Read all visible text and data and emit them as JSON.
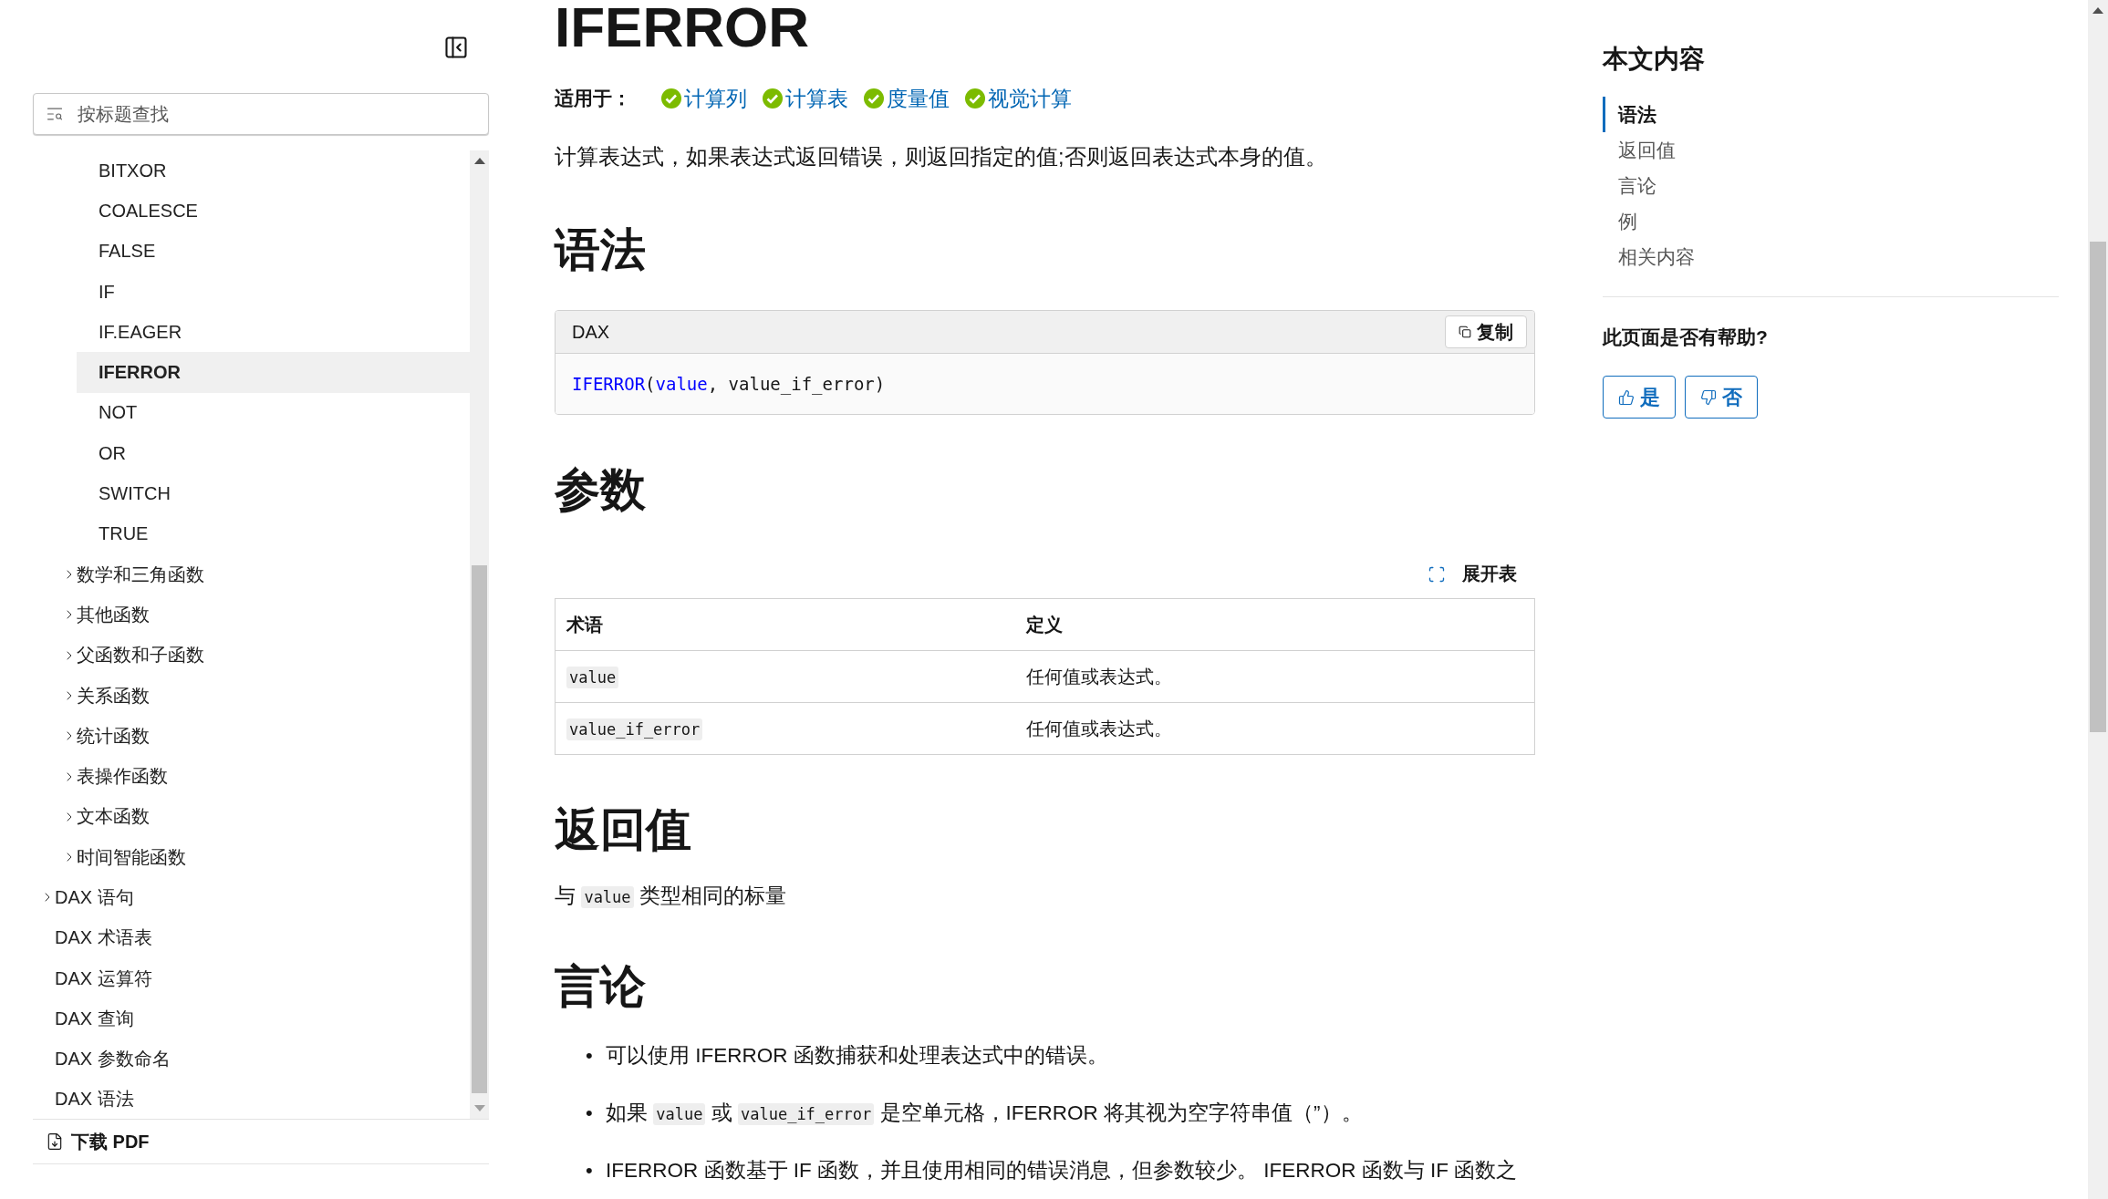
{
  "sidebar": {
    "search": {
      "placeholder": "按标题查找"
    },
    "tree": [
      {
        "children": [
          {
            "children": [
              {
                "label": "BITXOR",
                "selected": false
              },
              {
                "label": "COALESCE",
                "selected": false
              },
              {
                "label": "FALSE",
                "selected": false
              },
              {
                "label": "IF",
                "selected": false
              },
              {
                "label": "IF.EAGER",
                "selected": false
              },
              {
                "label": "IFERROR",
                "selected": true
              },
              {
                "label": "NOT",
                "selected": false
              },
              {
                "label": "OR",
                "selected": false
              },
              {
                "label": "SWITCH",
                "selected": false
              },
              {
                "label": "TRUE",
                "selected": false
              }
            ]
          },
          {
            "label": "数学和三角函数",
            "expanded": false,
            "selected": false
          },
          {
            "label": "其他函数",
            "expanded": false,
            "selected": false
          },
          {
            "label": "父函数和子函数",
            "expanded": false,
            "selected": false
          },
          {
            "label": "关系函数",
            "expanded": false,
            "selected": false
          },
          {
            "label": "统计函数",
            "expanded": false,
            "selected": false
          },
          {
            "label": "表操作函数",
            "expanded": false,
            "selected": false
          },
          {
            "label": "文本函数",
            "expanded": false,
            "selected": false
          },
          {
            "label": "时间智能函数",
            "expanded": false,
            "selected": false
          }
        ]
      },
      {
        "label": "DAX 语句",
        "expanded": false,
        "selected": false
      },
      {
        "label": "DAX 术语表",
        "selected": false
      },
      {
        "label": "DAX 运算符",
        "selected": false
      },
      {
        "label": "DAX 查询",
        "selected": false
      },
      {
        "label": "DAX 参数命名",
        "selected": false
      },
      {
        "label": "DAX 语法",
        "selected": false
      }
    ],
    "download": "下载 PDF"
  },
  "article": {
    "title": "IFERROR",
    "applies_to": {
      "label": "适用于：",
      "items": [
        "计算列",
        "计算表",
        "度量值",
        "视觉计算"
      ]
    },
    "description": "计算表达式，如果表达式返回错误，则返回指定的值;否则返回表达式本身的值。",
    "blocks": [
      {
        "kind": "heading",
        "text": "语法"
      },
      {
        "kind": "code",
        "language": "DAX",
        "copy": "复制",
        "tokens": [
          {
            "kind": "function",
            "text": "IFERROR"
          },
          {
            "kind": "plain",
            "text": "("
          },
          {
            "kind": "param",
            "text": "value"
          },
          {
            "kind": "plain",
            "text": ", value_if_error)"
          }
        ]
      },
      {
        "kind": "heading",
        "text": "参数"
      },
      {
        "kind": "table",
        "expand": "展开表",
        "columns": [
          "术语",
          "定义"
        ],
        "rows": [
          {
            "term": "value",
            "definition": "任何值或表达式。"
          },
          {
            "term": "value_if_error",
            "definition": "任何值或表达式。"
          }
        ]
      },
      {
        "kind": "heading",
        "text": "返回值"
      },
      {
        "kind": "paragraph",
        "segments": [
          {
            "kind": "text",
            "text": "与 "
          },
          {
            "kind": "code",
            "text": "value"
          },
          {
            "kind": "text",
            "text": " 类型相同的标量"
          }
        ]
      },
      {
        "kind": "heading",
        "text": "言论"
      },
      {
        "kind": "bullets",
        "items": [
          {
            "marker": "•",
            "segments": [
              {
                "kind": "text",
                "text": "可以使用 IFERROR 函数捕获和处理表达式中的错误。"
              }
            ]
          },
          {
            "marker": "•",
            "segments": [
              {
                "kind": "text",
                "text": "如果 "
              },
              {
                "kind": "code",
                "text": "value"
              },
              {
                "kind": "text",
                "text": " 或 "
              },
              {
                "kind": "code",
                "text": "value_if_error"
              },
              {
                "kind": "text",
                "text": " 是空单元格，IFERROR 将其视为空字符串值（”）。"
              }
            ]
          },
          {
            "marker": "•",
            "segments": [
              {
                "kind": "text",
                "text": "IFERROR 函数基于 IF 函数，并且使用相同的错误消息，但参数较少。 IFERROR 函数与 IF 函数之"
              }
            ]
          }
        ]
      }
    ]
  },
  "toc": {
    "title": "本文内容",
    "items": [
      {
        "label": "语法",
        "selected": true
      },
      {
        "label": "返回值",
        "selected": false
      },
      {
        "label": "言论",
        "selected": false
      },
      {
        "label": "例",
        "selected": false
      },
      {
        "label": "相关内容",
        "selected": false
      }
    ],
    "feedback": {
      "question": "此页面是否有帮助?",
      "buttons": [
        {
          "kind": "yes",
          "label": "是"
        },
        {
          "kind": "no",
          "label": "否"
        }
      ]
    }
  }
}
